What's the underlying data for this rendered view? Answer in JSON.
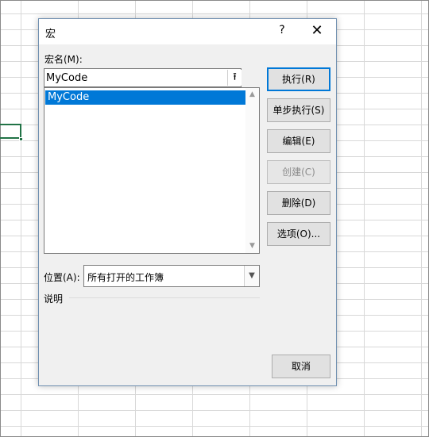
{
  "dialog": {
    "title": "宏",
    "help_icon": "?",
    "close_icon": "✕",
    "macro_name_label": "宏名(M):",
    "macro_name_value": "MyCode",
    "macros": [
      {
        "name": "MyCode",
        "selected": true
      }
    ],
    "buttons": {
      "run": "执行(R)",
      "step_into": "单步执行(S)",
      "edit": "编辑(E)",
      "create": "创建(C)",
      "delete": "删除(D)",
      "options": "选项(O)...",
      "cancel": "取消"
    },
    "location_label": "位置(A):",
    "location_value": "所有打开的工作簿",
    "description_label": "说明"
  },
  "colors": {
    "accent": "#0078d7",
    "selected_cell_border": "#217346",
    "dialog_bg": "#f0f0f0"
  },
  "icons": {
    "upload": "upload-icon",
    "close": "close-icon",
    "help": "help-icon",
    "dropdown": "chevron-down-icon"
  }
}
